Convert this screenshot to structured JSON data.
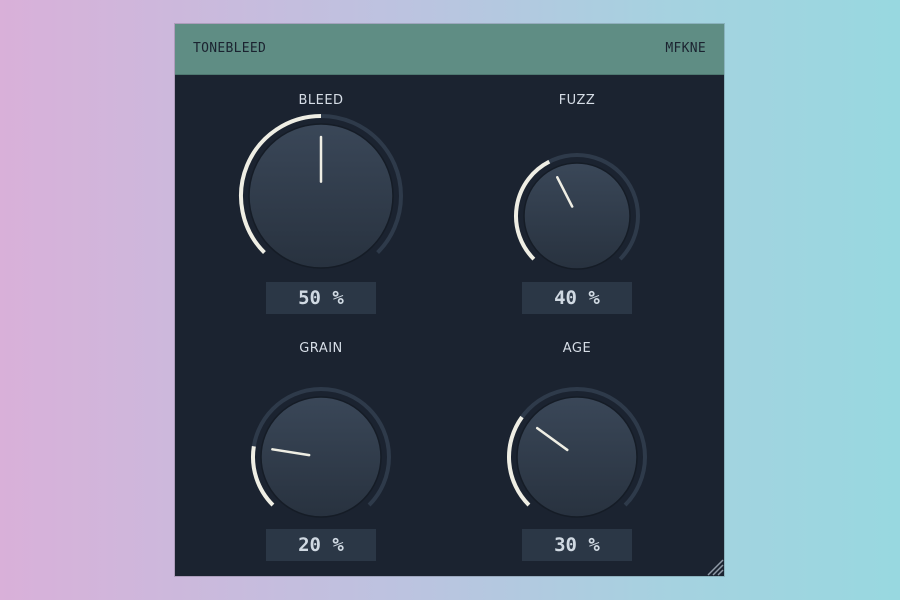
{
  "plugin": {
    "title": "TONEBLEED",
    "brand": "MFKNE"
  },
  "knobs": [
    {
      "label": "BLEED",
      "value_text": "50 %",
      "value": 0.5
    },
    {
      "label": "FUZZ",
      "value_text": "40 %",
      "value": 0.4
    },
    {
      "label": "GRAIN",
      "value_text": "20 %",
      "value": 0.2
    },
    {
      "label": "AGE",
      "value_text": "30 %",
      "value": 0.3
    }
  ],
  "colors": {
    "accent": "#efeee4",
    "panel": "#1b2330",
    "header": "#5f8d84",
    "knob_track": "#2e3a4a",
    "value_bg": "#2b3746"
  }
}
